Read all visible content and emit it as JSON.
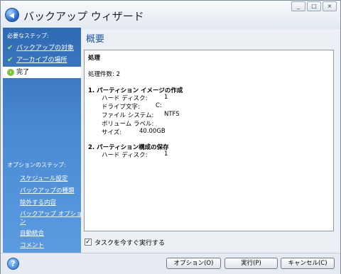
{
  "window": {
    "title": "バックアップ ウィザード",
    "controls": {
      "minimize": "_",
      "maximize": "□",
      "close": "×"
    }
  },
  "sidebar": {
    "required_title": "必要なステップ:",
    "required_steps": [
      {
        "label": "バックアップの対象",
        "state": "done",
        "icon": "check-icon"
      },
      {
        "label": "アーカイブの場所",
        "state": "done",
        "icon": "check-icon"
      },
      {
        "label": "完了",
        "state": "current",
        "icon": "arrow-right-icon"
      }
    ],
    "optional_title": "オプションのステップ:",
    "optional_steps": [
      {
        "label": "スケジュール設定"
      },
      {
        "label": "バックアップの種類"
      },
      {
        "label": "除外する内容"
      },
      {
        "label": "バックアップ オプショ"
      },
      {
        "label": "ン"
      },
      {
        "label": "自動統合"
      },
      {
        "label": "コメント"
      }
    ]
  },
  "main": {
    "title": "概要",
    "summary": {
      "heading": "処理",
      "count_line": "処理件数: 2",
      "op1_title": "1. パーティション イメージの作成",
      "op1_rows": [
        {
          "label": "ハード ディスク:",
          "value": "1"
        },
        {
          "label": "ドライブ文字:",
          "value": "C:"
        },
        {
          "label": "ファイル システム:",
          "value": "NTFS"
        },
        {
          "label": "ボリューム ラベル:",
          "value": ""
        },
        {
          "label": "サイズ:",
          "value": "40.00GB"
        }
      ],
      "op2_title": "2. パーティション構成の保存",
      "op2_rows": [
        {
          "label": "ハード ディスク:",
          "value": "1"
        }
      ]
    },
    "run_now": {
      "label": "タスクを今すぐ実行する",
      "checked": true,
      "mark": "✓"
    }
  },
  "footer": {
    "help": "?",
    "options_button": "オプション(O)",
    "run_button": "実行(P)",
    "cancel_button": "キャンセル(C)"
  },
  "colors": {
    "sidebar_top": "#2e6ab3",
    "sidebar_bottom": "#5b9be0",
    "title_accent": "#1d56a6",
    "check": "#9ef05a"
  }
}
